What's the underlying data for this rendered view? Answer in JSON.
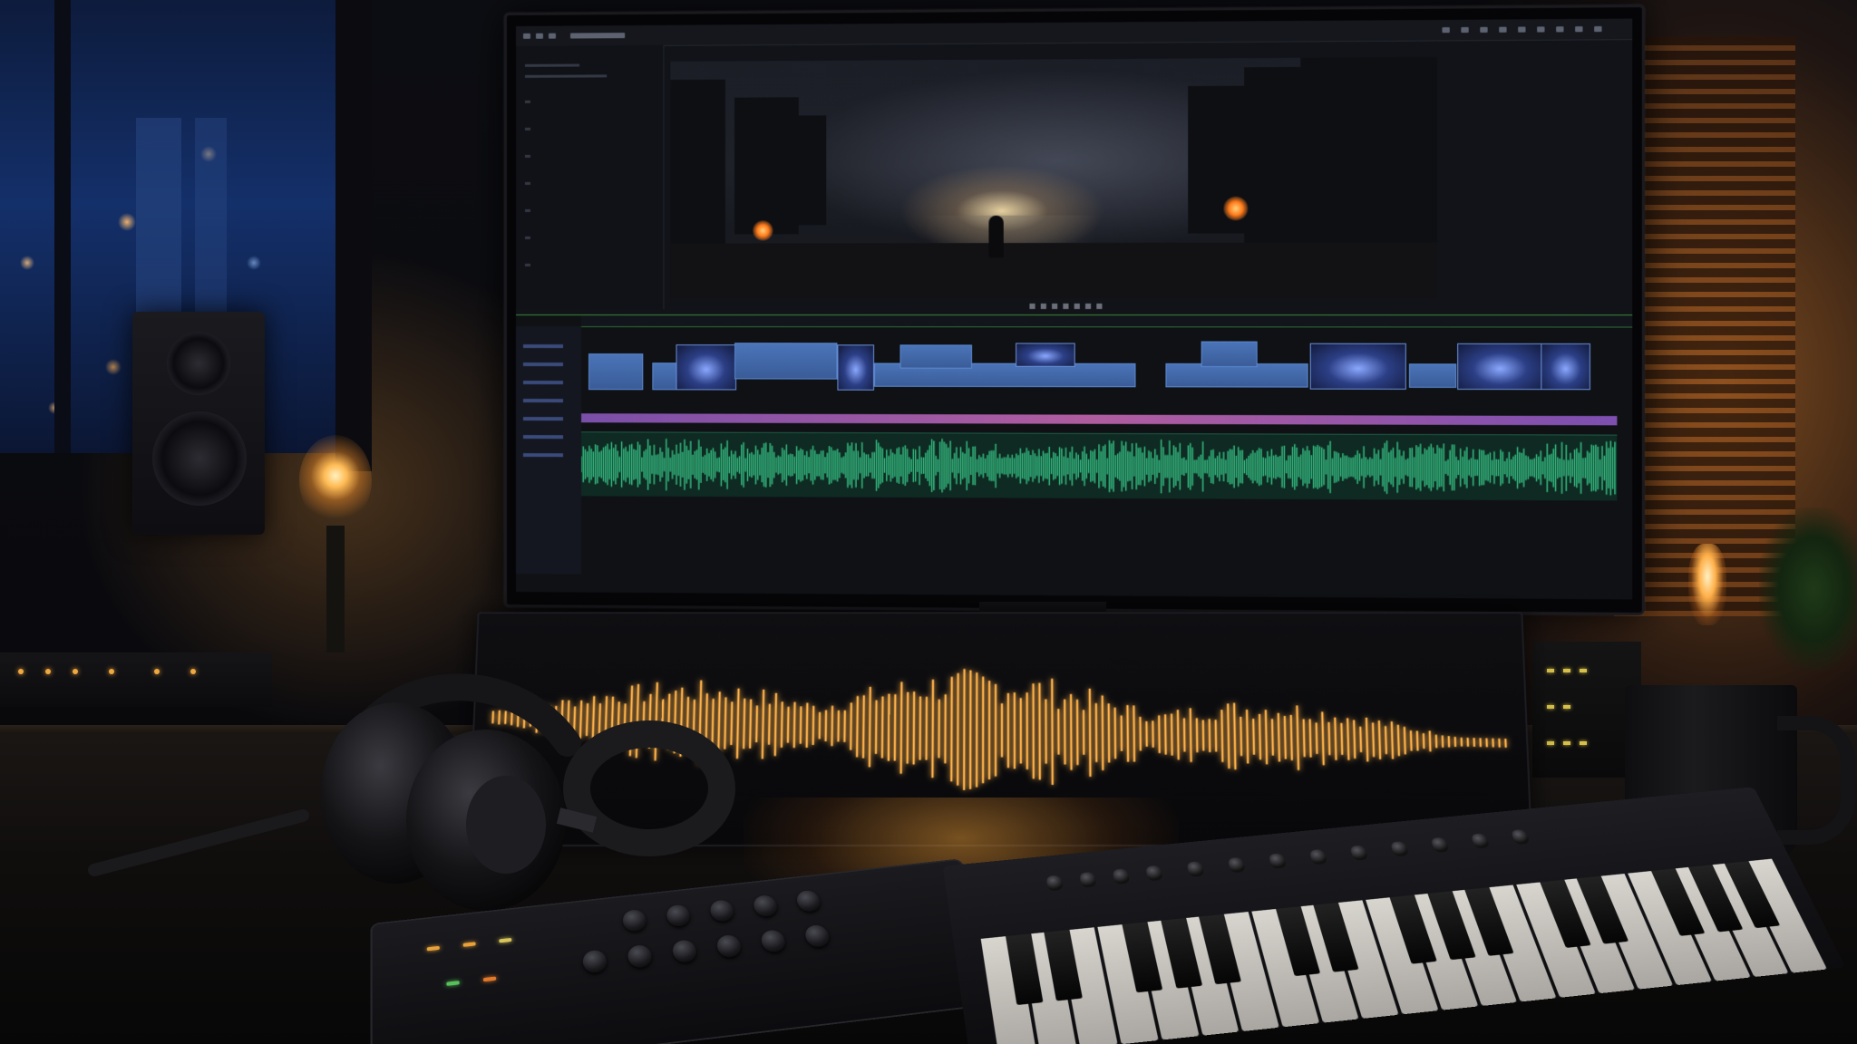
{
  "scene": {
    "description_label": "",
    "accent_colors": {
      "waveform": "#ffb24a",
      "audio_track": "#39c98a",
      "video_clip": "#4a74b8",
      "pink_track": "#b05da0",
      "lamp": "#ffbb55",
      "window_night": "#14306a"
    },
    "icons": [
      "monitor-icon",
      "headphones-icon",
      "keyboard-icon",
      "mixer-icon",
      "speaker-icon",
      "mug-icon",
      "lamp-icon"
    ]
  }
}
